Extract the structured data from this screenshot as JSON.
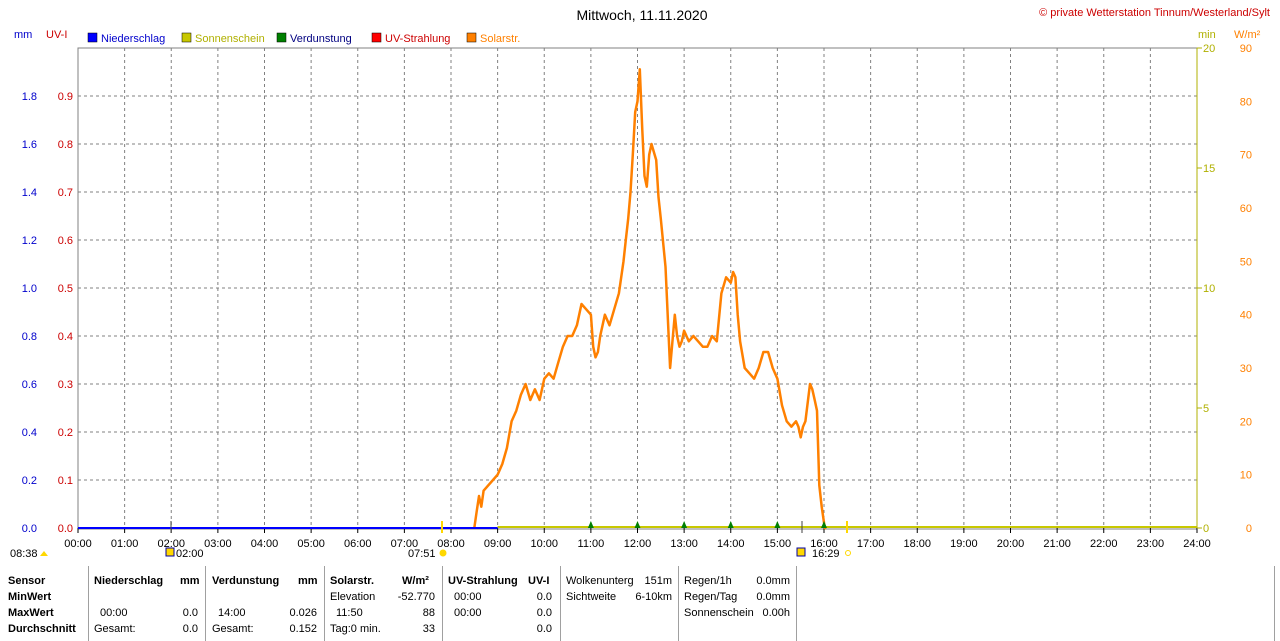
{
  "title": "Mittwoch, 11.11.2020",
  "copyright": "© private Wetterstation Tinnum/Westerland/Sylt",
  "legend": [
    {
      "label": "Niederschlag",
      "color": "#0000ff",
      "text_color": "#0000cc"
    },
    {
      "label": "Sonnenschein",
      "color": "#c8c800",
      "text_color": "#b0b000"
    },
    {
      "label": "Verdunstung",
      "color": "#008000",
      "text_color": "#000080"
    },
    {
      "label": "UV-Strahlung",
      "color": "#ff0000",
      "text_color": "#cc0000"
    },
    {
      "label": "Solarstr.",
      "color": "#ff8000",
      "text_color": "#ff8000"
    }
  ],
  "axis_units": {
    "left1": "mm",
    "left2": "UV-I",
    "right1": "min",
    "right2": "W/m²"
  },
  "sun_events": {
    "sunrise": "08:38",
    "moonset": "02:00",
    "dawn": "07:51",
    "moonrise": "16:29"
  },
  "chart_data": {
    "type": "line",
    "title": "Mittwoch, 11.11.2020",
    "x_ticks": [
      "00:00",
      "01:00",
      "02:00",
      "03:00",
      "04:00",
      "05:00",
      "06:00",
      "07:00",
      "08:00",
      "09:00",
      "10:00",
      "11:00",
      "12:00",
      "13:00",
      "14:00",
      "15:00",
      "16:00",
      "17:00",
      "18:00",
      "19:00",
      "20:00",
      "21:00",
      "22:00",
      "23:00",
      "24:00"
    ],
    "axes": {
      "mm": {
        "ticks": [
          "0.0",
          "0.2",
          "0.4",
          "0.6",
          "0.8",
          "1.0",
          "1.2",
          "1.4",
          "1.6",
          "1.8"
        ],
        "range": [
          0,
          2.0
        ]
      },
      "uv": {
        "ticks": [
          "0.0",
          "0.1",
          "0.2",
          "0.3",
          "0.4",
          "0.5",
          "0.6",
          "0.7",
          "0.8",
          "0.9"
        ],
        "range": [
          0,
          1.0
        ]
      },
      "min": {
        "ticks": [
          "0",
          "5",
          "10",
          "15",
          "20"
        ],
        "range": [
          0,
          20
        ]
      },
      "wm2": {
        "ticks": [
          "0",
          "10",
          "20",
          "30",
          "40",
          "50",
          "60",
          "70",
          "80",
          "90"
        ],
        "range": [
          0,
          90
        ]
      }
    },
    "grid": true,
    "series": [
      {
        "name": "Solarstr.",
        "axis": "wm2",
        "x": [
          8.5,
          8.55,
          8.6,
          8.65,
          8.7,
          8.8,
          8.9,
          9.0,
          9.1,
          9.2,
          9.3,
          9.4,
          9.5,
          9.6,
          9.7,
          9.8,
          9.9,
          10.0,
          10.1,
          10.2,
          10.3,
          10.4,
          10.5,
          10.6,
          10.7,
          10.8,
          10.9,
          11.0,
          11.05,
          11.1,
          11.15,
          11.2,
          11.3,
          11.4,
          11.5,
          11.6,
          11.7,
          11.75,
          11.8,
          11.85,
          11.9,
          11.95,
          12.0,
          12.05,
          12.1,
          12.15,
          12.2,
          12.25,
          12.3,
          12.4,
          12.45,
          12.5,
          12.6,
          12.7,
          12.8,
          12.85,
          12.9,
          12.95,
          13.0,
          13.1,
          13.2,
          13.3,
          13.4,
          13.5,
          13.6,
          13.7,
          13.8,
          13.9,
          14.0,
          14.05,
          14.1,
          14.15,
          14.2,
          14.3,
          14.4,
          14.5,
          14.6,
          14.7,
          14.8,
          14.9,
          15.0,
          15.1,
          15.2,
          15.3,
          15.4,
          15.45,
          15.5,
          15.55,
          15.6,
          15.7,
          15.75,
          15.8,
          15.85,
          15.9,
          15.95,
          16.0,
          16.02,
          16.05
        ],
        "values": [
          0,
          3,
          6,
          4,
          7,
          8,
          9,
          10,
          12,
          15,
          20,
          22,
          25,
          27,
          24,
          26,
          24,
          28,
          29,
          28,
          31,
          34,
          36,
          36,
          38,
          42,
          41,
          40,
          34,
          32,
          33,
          36,
          40,
          38,
          41,
          44,
          50,
          54,
          58,
          63,
          70,
          78,
          80,
          86,
          75,
          66,
          64,
          70,
          72,
          69,
          62,
          58,
          49,
          30,
          40,
          36,
          34,
          35,
          37,
          35,
          36,
          35,
          34,
          34,
          36,
          35,
          44,
          47,
          46,
          48,
          47,
          40,
          35,
          30,
          29,
          28,
          30,
          33,
          33,
          30,
          28,
          23,
          20,
          19,
          20,
          19,
          17,
          19,
          20,
          27,
          26,
          24,
          22,
          8,
          4,
          1,
          0,
          0
        ]
      },
      {
        "name": "Sonnenschein",
        "axis": "min",
        "x": [
          9.0,
          24.0
        ],
        "values": [
          0,
          0
        ]
      },
      {
        "name": "Niederschlag",
        "axis": "mm",
        "x": [
          0.0,
          9.0
        ],
        "values": [
          0,
          0
        ]
      },
      {
        "name": "Verdunstung",
        "axis": "mm",
        "x": [
          11.0,
          12.0,
          13.0,
          14.0,
          15.0,
          16.0
        ],
        "values": [
          0.026,
          0.026,
          0.026,
          0.026,
          0.026,
          0.026
        ]
      }
    ]
  },
  "stats": {
    "row_labels": [
      "Sensor",
      "MinWert",
      "MaxWert",
      "Durchschnitt"
    ],
    "niederschlag": {
      "header": "Niederschlag",
      "unit": "mm",
      "max_time": "00:00",
      "max_val": "0.0",
      "gesamt_label": "Gesamt:",
      "gesamt_val": "0.0"
    },
    "verdunstung": {
      "header": "Verdunstung",
      "unit": "mm",
      "max_time": "14:00",
      "max_val": "0.026",
      "gesamt_label": "Gesamt:",
      "gesamt_val": "0.152"
    },
    "solar": {
      "header": "Solarstr.",
      "unit": "W/m²",
      "elev_label": "Elevation",
      "elev_val": "-52.770",
      "max_time": "11:50",
      "max_val": "88",
      "tag_label": "Tag:0 min.",
      "avg_val": "33"
    },
    "uv": {
      "header": "UV-Strahlung",
      "unit": "UV-I",
      "min_time": "00:00",
      "min_val": "0.0",
      "max_time": "00:00",
      "max_val": "0.0",
      "avg_val": "0.0"
    },
    "wolken": {
      "label1": "Wolkenunterg",
      "val1": "151m",
      "label2": "Sichtweite",
      "val2": "6-10km"
    },
    "regen": {
      "label1": "Regen/1h",
      "val1": "0.0mm",
      "label2": "Regen/Tag",
      "val2": "0.0mm",
      "label3": "Sonnenschein",
      "val3": "0.00h"
    }
  }
}
